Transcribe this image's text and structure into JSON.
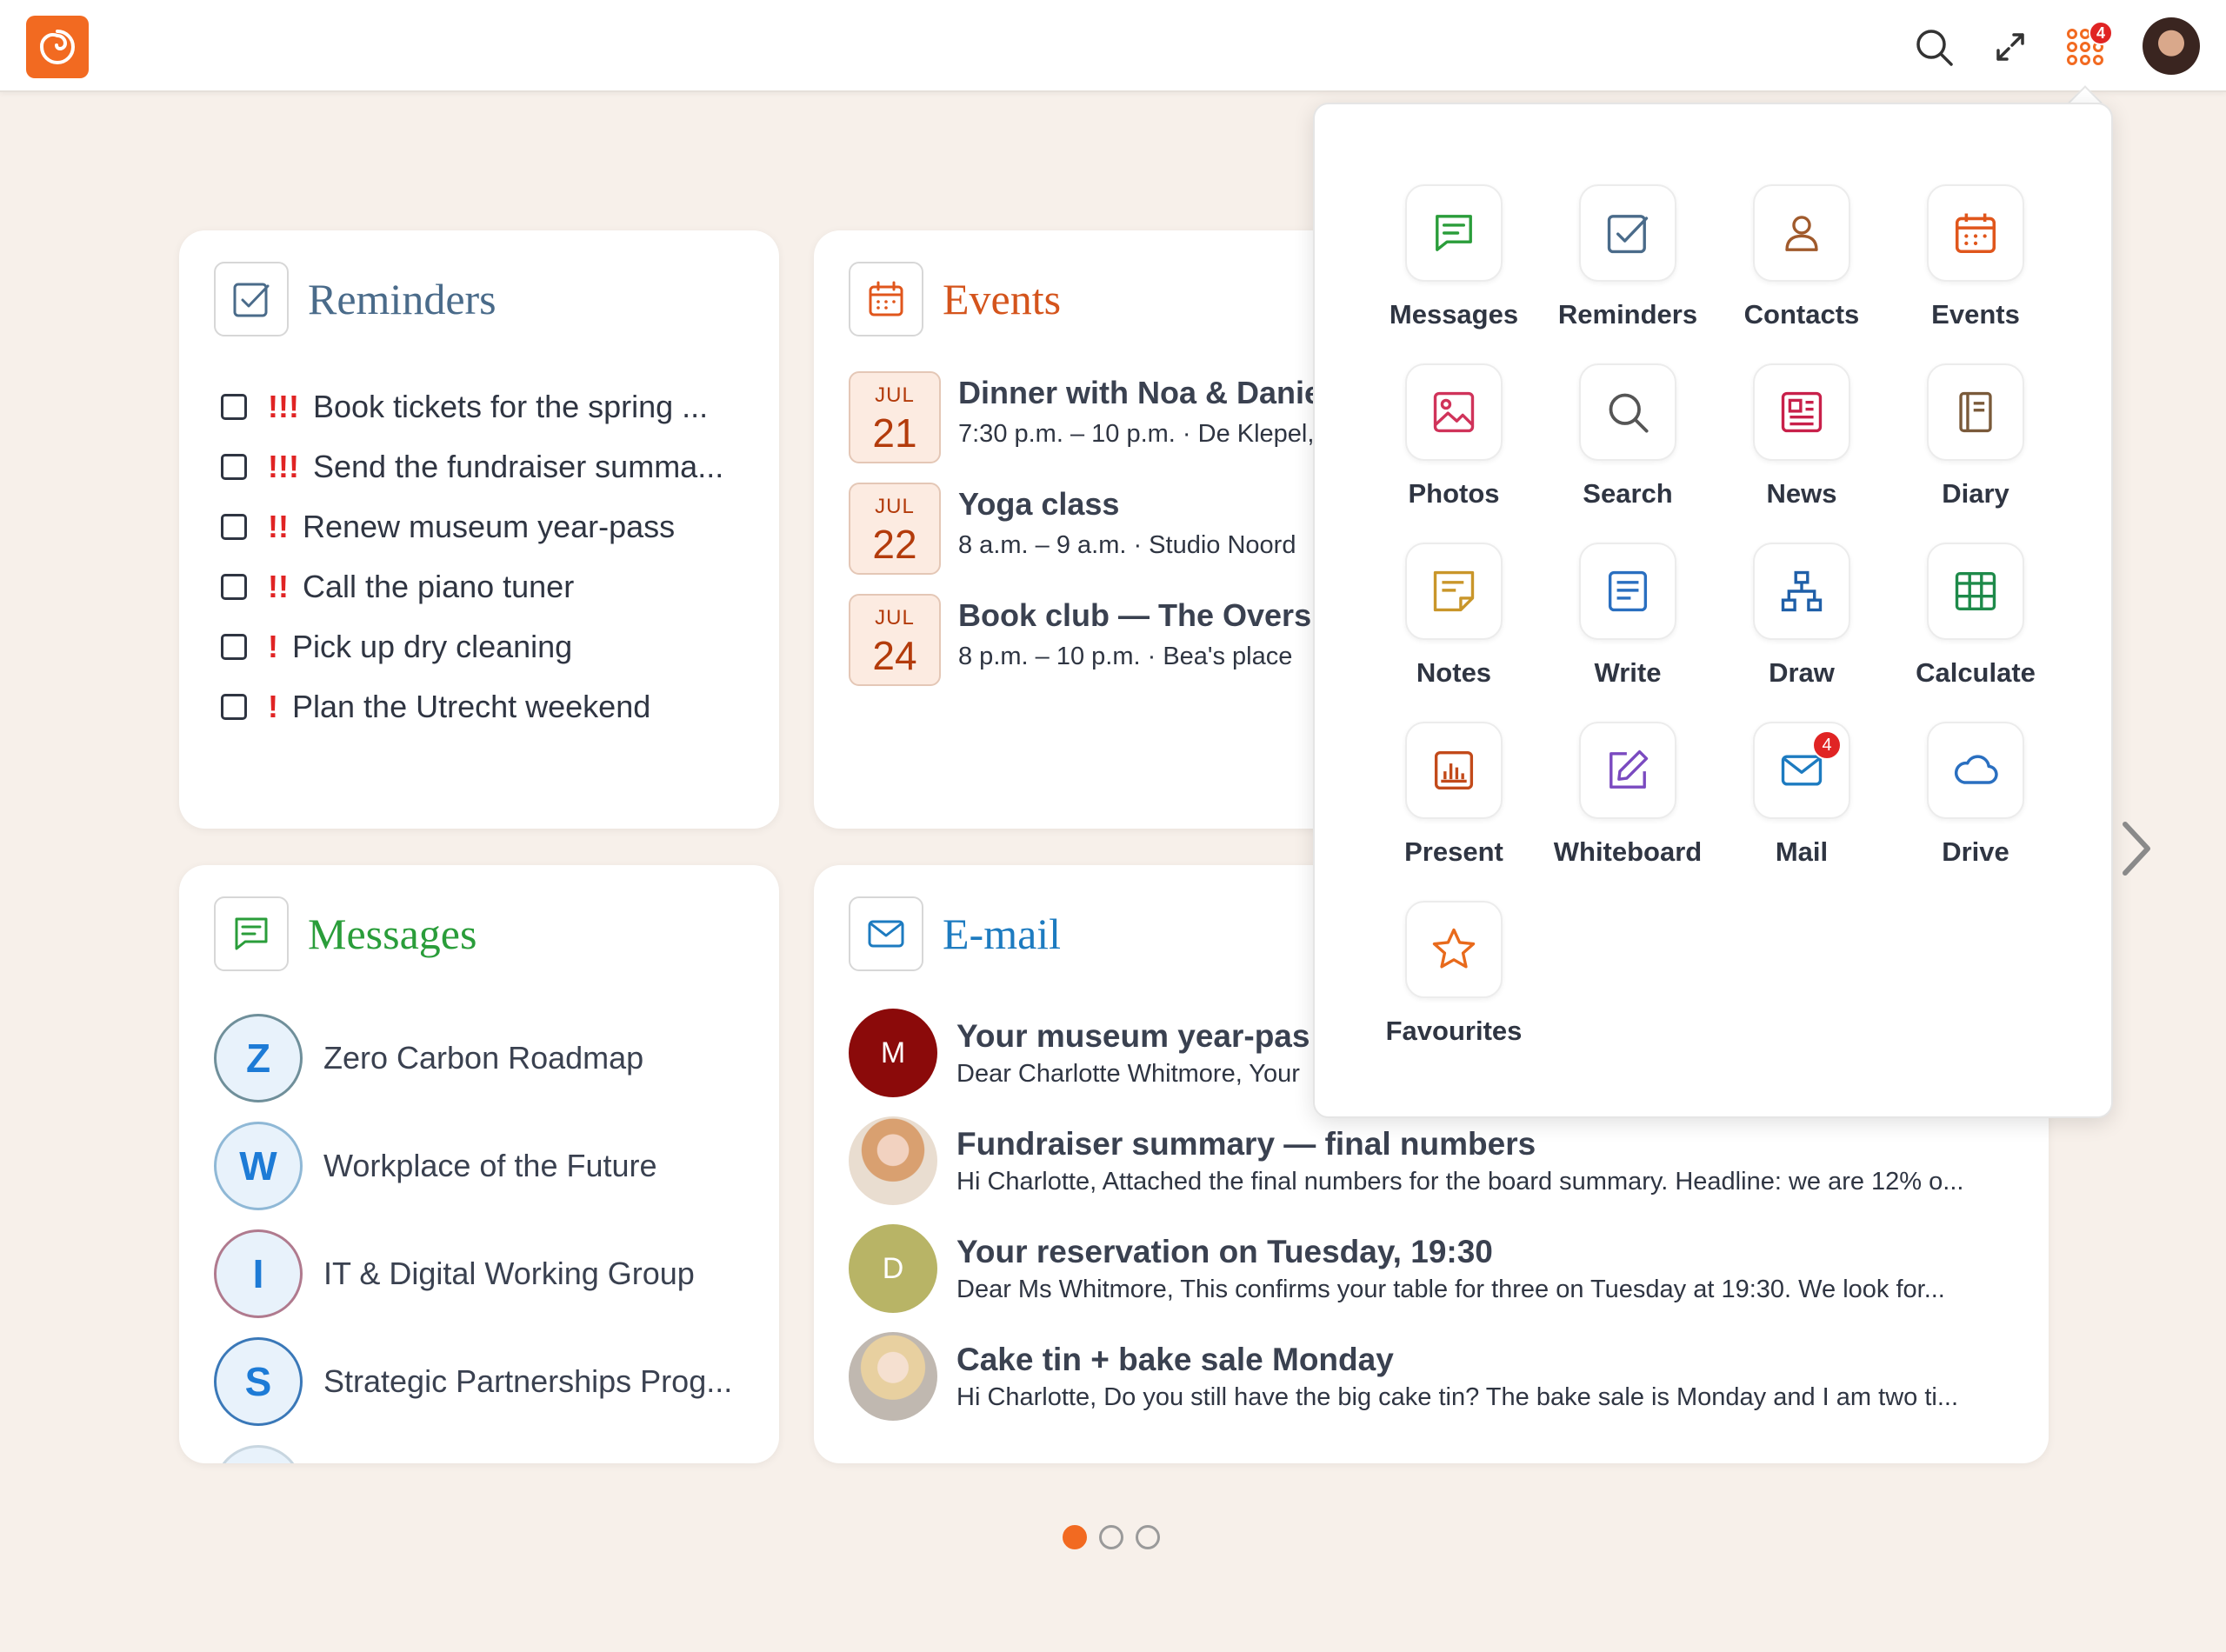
{
  "topbar": {
    "logo_icon": "brand-swirl-icon",
    "icons": [
      "search-icon",
      "fullscreen-icon",
      "apps-grid-icon"
    ],
    "apps_badge": "4",
    "accent": "#f26a21"
  },
  "reminders": {
    "title": "Reminders",
    "title_color": "#4a6b8a",
    "items": [
      {
        "priority": "!!!",
        "text": "Book tickets for the spring ..."
      },
      {
        "priority": "!!!",
        "text": "Send the fundraiser summa..."
      },
      {
        "priority": "!!",
        "text": "Renew museum year-pass"
      },
      {
        "priority": "!!",
        "text": "Call the piano tuner"
      },
      {
        "priority": "!",
        "text": "Pick up dry cleaning"
      },
      {
        "priority": "!",
        "text": "Plan the Utrecht weekend"
      }
    ]
  },
  "events": {
    "title": "Events",
    "title_color": "#d4541c",
    "items": [
      {
        "month": "JUL",
        "day": "21",
        "title": "Dinner with Noa & Danie",
        "sub": "7:30 p.m. – 10 p.m. · De Klepel,"
      },
      {
        "month": "JUL",
        "day": "22",
        "title": "Yoga class",
        "sub": "8 a.m. – 9 a.m. · Studio Noord"
      },
      {
        "month": "JUL",
        "day": "24",
        "title": "Book club — The Overs",
        "sub": "8 p.m. – 10 p.m. · Bea's place"
      }
    ]
  },
  "messages": {
    "title": "Messages",
    "title_color": "#2a9d3a",
    "items": [
      {
        "initial": "Z",
        "name": "Zero Carbon Roadmap"
      },
      {
        "initial": "W",
        "name": "Workplace of the Future"
      },
      {
        "initial": "I",
        "name": "IT & Digital Working Group"
      },
      {
        "initial": "S",
        "name": "Strategic Partnerships Prog..."
      }
    ]
  },
  "email": {
    "title": "E-mail",
    "title_color": "#1d7bc0",
    "items": [
      {
        "initial": "M",
        "color": "#8b0a0a",
        "subject": "Your museum year-pas",
        "preview": "Dear Charlotte Whitmore, Your"
      },
      {
        "initial": "",
        "color": "#c89a86",
        "subject": "Fundraiser summary — final numbers",
        "preview": "Hi Charlotte, Attached the final numbers for the board summary. Headline: we are 12% o..."
      },
      {
        "initial": "D",
        "color": "#b8b466",
        "subject": "Your reservation on Tuesday, 19:30",
        "preview": "Dear Ms Whitmore, This confirms your table for three on Tuesday at 19:30. We look for..."
      },
      {
        "initial": "",
        "color": "#d8c4a8",
        "subject": "Cake tin + bake sale Monday",
        "preview": "Hi Charlotte, Do you still have the big cake tin? The bake sale is Monday and I am two ti..."
      }
    ]
  },
  "launcher": {
    "apps": [
      {
        "label": "Messages",
        "icon": "chat-icon",
        "color": "#2a9d3a"
      },
      {
        "label": "Reminders",
        "icon": "checkbox-icon",
        "color": "#4a6b8a"
      },
      {
        "label": "Contacts",
        "icon": "person-icon",
        "color": "#a05a2c"
      },
      {
        "label": "Events",
        "icon": "calendar-icon",
        "color": "#e0561c"
      },
      {
        "label": "Photos",
        "icon": "image-icon",
        "color": "#d0335a"
      },
      {
        "label": "Search",
        "icon": "search-icon",
        "color": "#555555"
      },
      {
        "label": "News",
        "icon": "newspaper-icon",
        "color": "#c8204a"
      },
      {
        "label": "Diary",
        "icon": "notebook-icon",
        "color": "#7a5a3a"
      },
      {
        "label": "Notes",
        "icon": "note-icon",
        "color": "#c9962a"
      },
      {
        "label": "Write",
        "icon": "document-icon",
        "color": "#2a6fc0"
      },
      {
        "label": "Draw",
        "icon": "diagram-icon",
        "color": "#1f5fa8"
      },
      {
        "label": "Calculate",
        "icon": "spreadsheet-icon",
        "color": "#1e8a4a"
      },
      {
        "label": "Present",
        "icon": "presentation-icon",
        "color": "#c24a1a"
      },
      {
        "label": "Whiteboard",
        "icon": "pencil-square-icon",
        "color": "#7a4ac0"
      },
      {
        "label": "Mail",
        "icon": "envelope-icon",
        "color": "#1d7bc0",
        "badge": "4"
      },
      {
        "label": "Drive",
        "icon": "cloud-icon",
        "color": "#2a6fc0"
      },
      {
        "label": "Favourites",
        "icon": "star-icon",
        "color": "#e86a1c"
      }
    ]
  },
  "pager": {
    "count": 3,
    "active": 0
  }
}
